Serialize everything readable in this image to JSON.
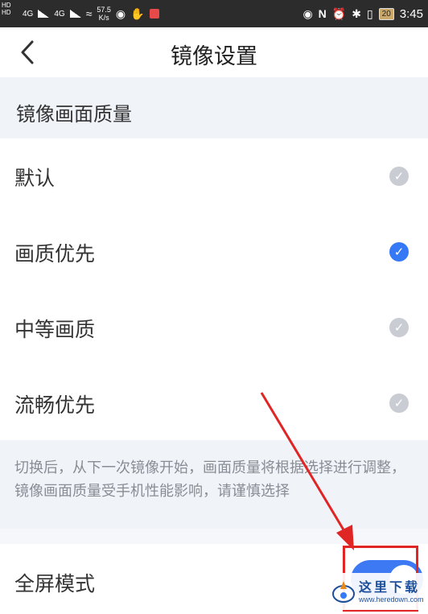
{
  "statusbar": {
    "network_speed": "57.5",
    "network_unit": "K/s",
    "network_type_1": "4G",
    "network_type_2": "4G",
    "hd_label": "HD",
    "battery_level": "20",
    "time": "3:45"
  },
  "header": {
    "back_icon": "chevron-left-icon",
    "title": "镜像设置"
  },
  "section": {
    "title": "镜像画面质量"
  },
  "options": [
    {
      "label": "默认",
      "selected": false
    },
    {
      "label": "画质优先",
      "selected": true
    },
    {
      "label": "中等画质",
      "selected": false
    },
    {
      "label": "流畅优先",
      "selected": false
    }
  ],
  "note": {
    "text": "切换后，从下一次镜像开始，画面质量将根据选择进行调整，镜像画面质量受手机性能影响，请谨慎选择"
  },
  "fullscreen": {
    "label": "全屏模式",
    "enabled": true
  },
  "watermark": {
    "title": "这里下载",
    "url": "www.heredown.com"
  },
  "colors": {
    "accent": "#3579f6",
    "check_inactive": "#c9ccd2",
    "annotation": "#e02525"
  }
}
